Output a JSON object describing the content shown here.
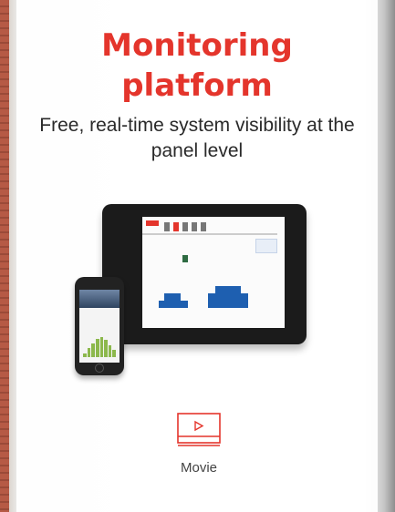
{
  "title_line1": "Monitoring",
  "title_line2": "platform",
  "subtitle": "Free, real-time system visibility at the panel level",
  "movie": {
    "label": "Movie",
    "icon": "video-play-icon"
  },
  "colors": {
    "accent": "#e4352c",
    "text": "#2a2a2a"
  }
}
